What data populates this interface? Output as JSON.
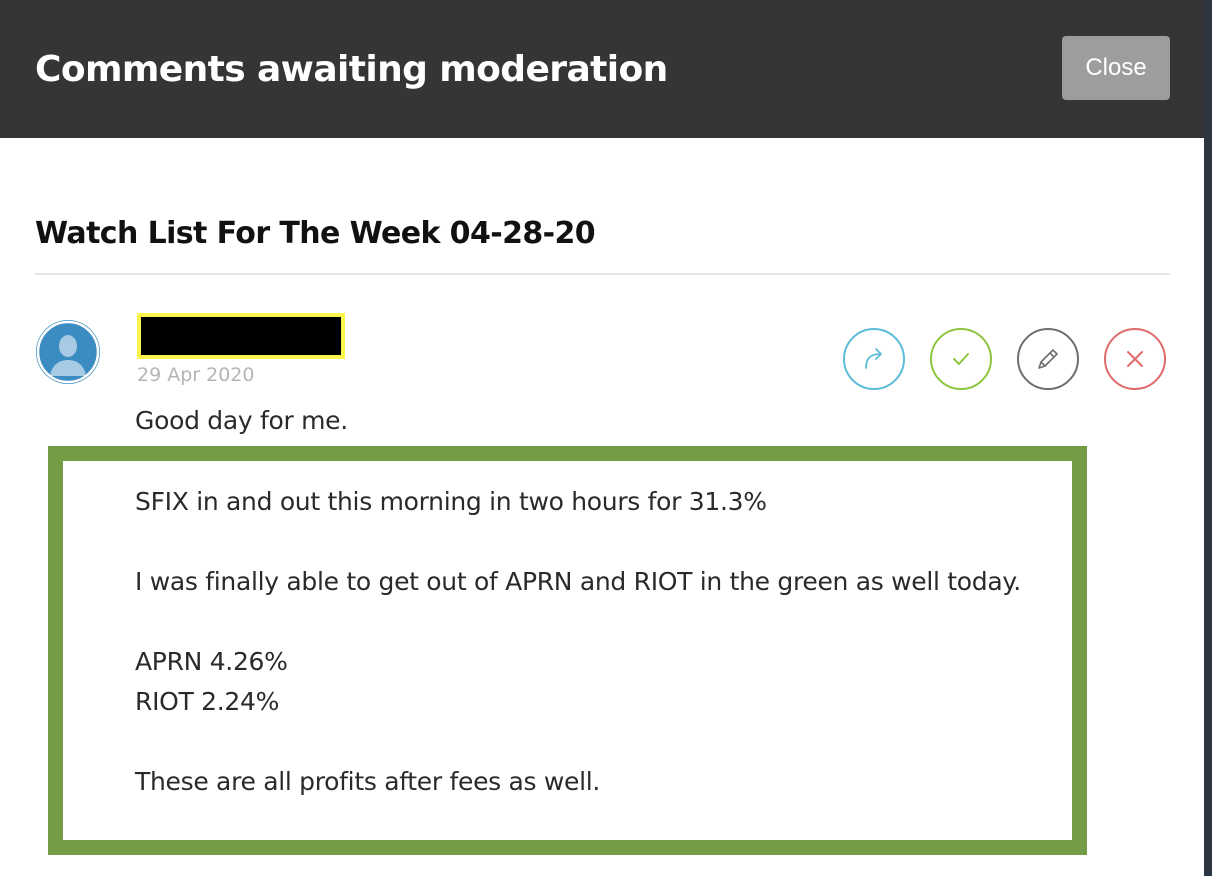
{
  "header": {
    "title": "Comments awaiting moderation",
    "close_label": "Close"
  },
  "post": {
    "title": "Watch List For The Week 04-28-20"
  },
  "comment": {
    "author": "",
    "date": "29 Apr 2020",
    "lines": [
      "Good day for me.",
      "SFIX in and out this morning in two hours for 31.3%",
      "I was finally able to get out of APRN and RIOT in the green as well today.",
      "APRN 4.26%",
      "RIOT 2.24%",
      "These are all profits after fees as well."
    ],
    "actions": {
      "reply": "reply-icon",
      "approve": "check-icon",
      "edit": "pencil-icon",
      "delete": "x-icon"
    }
  },
  "colors": {
    "header_bg": "#353535",
    "close_bg": "#9d9d9d",
    "avatar": "#3c8cc4",
    "redaction": "#000000",
    "redaction_border": "#fcf44c",
    "highlight_border": "#749c45",
    "reply": "#5bbcd8",
    "approve": "#8dc63f",
    "edit": "#6f6f6f",
    "delete": "#e06b6b"
  }
}
